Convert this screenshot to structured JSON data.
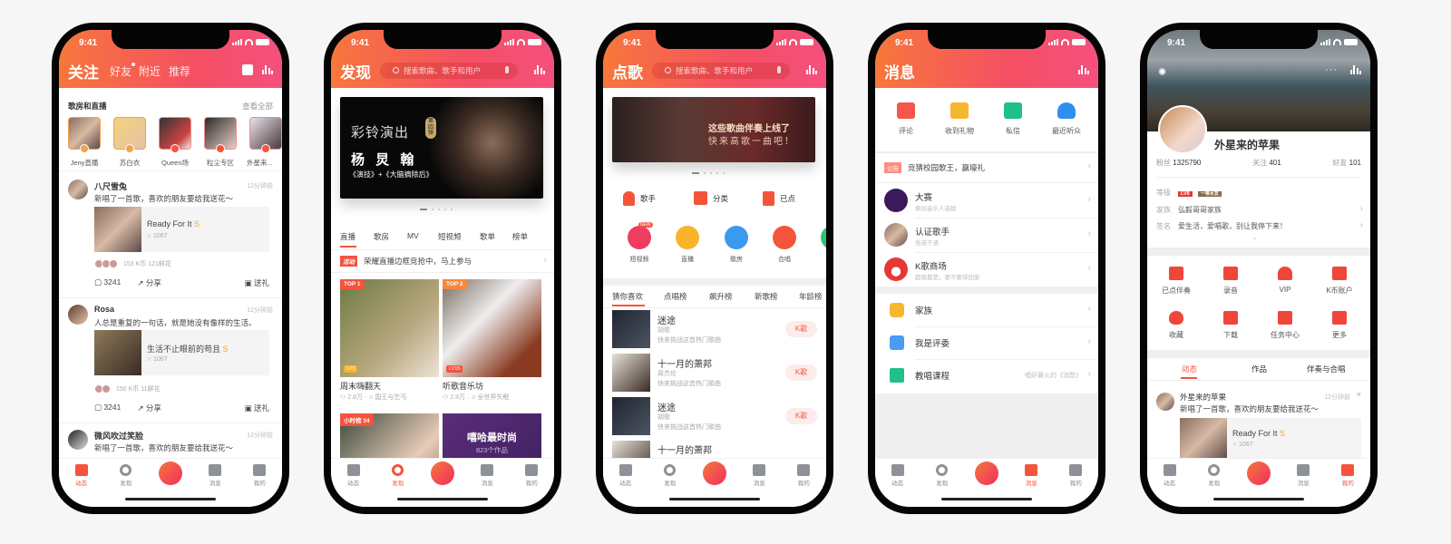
{
  "status_time": "9:41",
  "accent_color": "#f5533d",
  "header_gradient": [
    "#f7773a",
    "#f4507d"
  ],
  "tabbar": [
    {
      "label": "动态",
      "icon": "message-square-icon"
    },
    {
      "label": "发现",
      "icon": "search-icon"
    },
    {
      "label": "",
      "icon": "sing-center-icon"
    },
    {
      "label": "消息",
      "icon": "envelope-icon"
    },
    {
      "label": "我的",
      "icon": "mascot-icon"
    }
  ],
  "follow": {
    "active_tab": 0,
    "title": "关注",
    "top_tabs": [
      "好友",
      "附近",
      "推荐"
    ],
    "section_title": "歌房和直播",
    "see_all": "查看全部",
    "rooms": [
      "Jeny直播",
      "苏白衣",
      "Queen场",
      "粒尘专区",
      "外星来..."
    ],
    "posts": [
      {
        "name": "八尺雪兔",
        "time": "12分钟前",
        "text": "新唱了一首歌，喜欢的朋友要给我送花～",
        "song": "Ready For It",
        "grade": "S",
        "plays": "1067",
        "gifts": "153 K币  121鲜花",
        "comments": "3241",
        "share": "分享",
        "gift": "送礼"
      },
      {
        "name": "Rosa",
        "time": "12分钟前",
        "text": "人总是重复的一句话，就是她没有像样的生活。",
        "song": "生活不止眼前的苟且",
        "grade": "S",
        "plays": "1067",
        "gifts": "150 K币  11鲜花",
        "comments": "3241",
        "share": "分享",
        "gift": "送礼"
      },
      {
        "name": "微风吹过笑脸",
        "time": "12分钟前",
        "text": "新唱了一首歌，喜欢的朋友要给我送花～"
      }
    ]
  },
  "discover": {
    "active_tab": 1,
    "title": "发现",
    "search_placeholder": "搜索歌曲、歌手和用户",
    "banner": {
      "logo": "彩铃演出",
      "season": "第四弹",
      "artist": "杨 炅 翰",
      "songs": "《演技》+《大脑摘除后》"
    },
    "tabs": [
      "直播",
      "歌房",
      "MV",
      "短视频",
      "歌单",
      "榜单"
    ],
    "activity_badge": "活动",
    "activity_text": "荣耀直播边框竞抢中，马上参与",
    "cards": [
      {
        "tag": "TOP 1",
        "level": "LV3",
        "title": "周末嗨翻天",
        "listeners": "2.8万",
        "song": "国王与乞丐"
      },
      {
        "tag": "TOP 2",
        "level": "LV15",
        "title": "听歌音乐坊",
        "listeners": "2.8万",
        "song": "全世界失眠"
      },
      {
        "tag": "小时榜 34"
      },
      {
        "title": "嘻哈最时尚",
        "count": "823个作品"
      }
    ]
  },
  "sing": {
    "active_tab": 2,
    "title": "点歌",
    "search_placeholder": "搜索歌曲、歌手和用户",
    "banner": {
      "line1": "这些歌曲伴奏上线了",
      "line2": "快来高歌一曲吧！"
    },
    "quick": [
      "歌手",
      "分类",
      "已点"
    ],
    "categories": [
      {
        "label": "短视频",
        "color": "#ef3d5f",
        "badge": "NEW"
      },
      {
        "label": "直播",
        "color": "#f8b42a"
      },
      {
        "label": "歌房",
        "color": "#3a9af0"
      },
      {
        "label": "合唱",
        "color": "#f4553a"
      },
      {
        "label": "",
        "color": "#2cc27a"
      }
    ],
    "rank_tabs": [
      "猜你喜欢",
      "点唱榜",
      "飙升榜",
      "新歌榜",
      "年龄榜"
    ],
    "songs": [
      {
        "title": "迷途",
        "artist": "胡歌",
        "desc": "快来挑战这首热门歌曲",
        "button": "K歌"
      },
      {
        "title": "十一月的萧邦",
        "artist": "周杰伦",
        "desc": "快来挑战这首热门歌曲",
        "button": "K歌"
      },
      {
        "title": "迷途",
        "artist": "胡歌",
        "desc": "快来挑战这首热门歌曲",
        "button": "K歌"
      },
      {
        "title": "十一月的萧邦"
      }
    ]
  },
  "messages": {
    "active_tab": 3,
    "title": "消息",
    "shortcuts": [
      {
        "label": "评论",
        "color": "#f5574a"
      },
      {
        "label": "收到礼物",
        "color": "#f8b62e"
      },
      {
        "label": "私信",
        "color": "#1fc08a"
      },
      {
        "label": "最近听众",
        "color": "#2f8ff0"
      }
    ],
    "notice_badge": "公告",
    "notice_text": "竞猜校园歌王，赢壕礼",
    "rows": [
      {
        "title": "大赛",
        "sub": "原创音乐人选拔"
      },
      {
        "title": "认证歌手",
        "sub": "张诺千语"
      },
      {
        "title": "K歌商场",
        "sub": "超萌靠垫，要不要带回家"
      }
    ],
    "features": [
      {
        "title": "家族",
        "color": "#f8b62e"
      },
      {
        "title": "我是评委",
        "color": "#4a9cf2"
      },
      {
        "title": "教唱课程",
        "color": "#1fc08a",
        "hint": "唱好最火的《消愁》"
      }
    ]
  },
  "profile": {
    "active_tab": 4,
    "name": "外星来的苹果",
    "stats": [
      {
        "label": "粉丝",
        "value": "1325790"
      },
      {
        "label": "关注",
        "value": "401"
      },
      {
        "label": "好友",
        "value": "101"
      }
    ],
    "level_label": "等级",
    "level_badge": "LV8",
    "level_badge2": "一等水友",
    "family_label": "家族",
    "family_value": "弘毅哥哥家族",
    "sign_label": "签名",
    "sign_value": "爱生活，爱唱歌，别让我停下来！",
    "grid": [
      "已点伴奏",
      "录音",
      "VIP",
      "K币账户",
      "收藏",
      "下载",
      "任务中心",
      "更多"
    ],
    "tabs": [
      "动态",
      "作品",
      "伴奏与合唱"
    ],
    "post": {
      "name": "外星来的苹果",
      "time": "12分钟前",
      "text": "新唱了一首歌，喜欢的朋友要给我送花～",
      "song": "Ready For It",
      "grade": "S",
      "plays": "1067"
    }
  }
}
